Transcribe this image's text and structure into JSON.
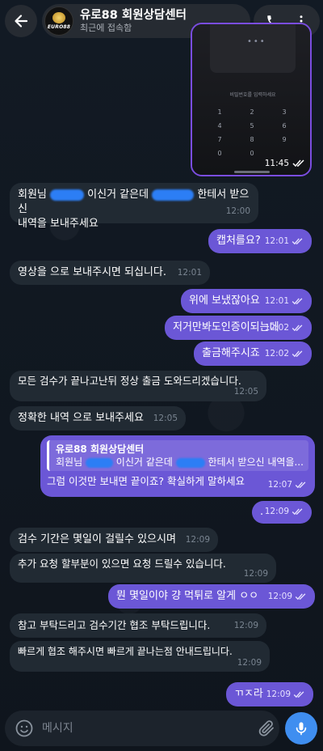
{
  "header": {
    "name": "유로88 회원상담센터",
    "status": "최근에 접속함",
    "avatar_brand": "EURO88"
  },
  "image_message": {
    "dots": "•••",
    "caption": "비밀번호를 입력하세요",
    "keypad": [
      "1",
      "2",
      "3",
      "4",
      "5",
      "6",
      "7",
      "8",
      "9",
      "0",
      "0",
      ""
    ],
    "time": "11:45"
  },
  "messages": [
    {
      "id": "m1",
      "dir": "in",
      "line1_a": "회원님",
      "line1_b": "이신거 같은데",
      "line1_c": "한테서 받으신",
      "line2": "내역을 보내주세요",
      "time": "12:00"
    },
    {
      "id": "m2",
      "dir": "out",
      "text": "캡처를요?",
      "time": "12:01"
    },
    {
      "id": "m3",
      "dir": "in",
      "text": "영상을 으로 보내주시면 되십니다.",
      "time": "12:01"
    },
    {
      "id": "m4",
      "dir": "out",
      "text": "위에 보냈잖아요",
      "time": "12:01"
    },
    {
      "id": "m5",
      "dir": "out",
      "text": "저거만봐도인증이되는데",
      "time": "12:02"
    },
    {
      "id": "m6",
      "dir": "out",
      "text": "출금해주시죠",
      "time": "12:02"
    },
    {
      "id": "m7",
      "dir": "in",
      "text": "모든 검수가 끝나고난뒤 정상 출금 도와드리겠습니다.",
      "time": "12:05"
    },
    {
      "id": "m8",
      "dir": "in",
      "text": "정확한 내역 으로 보내주세요",
      "time": "12:05"
    },
    {
      "id": "m9",
      "dir": "out",
      "quote_name": "유로88 회원상담센터",
      "quote_a": "회원님",
      "quote_b": "이신거 같은데",
      "quote_c": "한테서 받으신 내역을...",
      "text": "그럼 이것만 보내면 끝이죠? 확실하게 말하세요",
      "time": "12:07"
    },
    {
      "id": "m10",
      "dir": "out",
      "text": ".",
      "time": "12:09"
    },
    {
      "id": "m11",
      "dir": "in",
      "text": "검수 기간은 몇일이 걸릴수 있으시며",
      "time": "12:09"
    },
    {
      "id": "m12",
      "dir": "in",
      "text": "추가 요청 할부분이 있으면 요청 드릴수 있습니다.",
      "time": "12:09"
    },
    {
      "id": "m13",
      "dir": "out",
      "text": "뭔 몇일이야 걍 먹튀로 알게 ㅇㅇ",
      "time": "12:09"
    },
    {
      "id": "m14",
      "dir": "in",
      "text": "참고 부탁드리고 검수기간 협조 부탁드립니다.",
      "time": "12:09"
    },
    {
      "id": "m15",
      "dir": "in",
      "text": "빠르게 협조 해주시면 빠르게 끝나는점 안내드립니다.",
      "time": "12:09"
    },
    {
      "id": "m16",
      "dir": "out",
      "text": "ㄲㅈ라",
      "time": "12:09"
    }
  ],
  "composer": {
    "placeholder": "메시지"
  },
  "colors": {
    "outgoing": "#6b57d6",
    "incoming": "#212a33",
    "accent": "#3f8ef0"
  }
}
